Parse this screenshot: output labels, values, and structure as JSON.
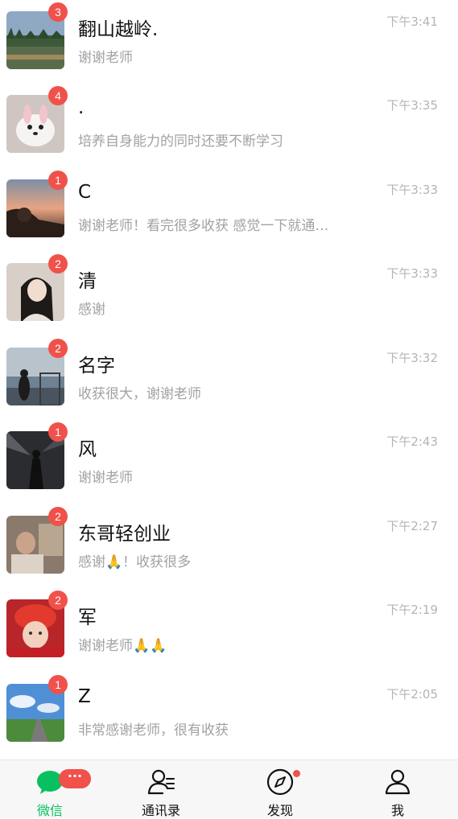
{
  "chats": [
    {
      "name": "翻山越岭.",
      "preview": "谢谢老师",
      "time": "下午3:41",
      "unread": "3",
      "avatar": "landscape-avatar"
    },
    {
      "name": ".",
      "preview": "培养自身能力的同时还要不断学习",
      "time": "下午3:35",
      "unread": "4",
      "avatar": "white-dog-avatar"
    },
    {
      "name": "C",
      "preview": "谢谢老师！看完很多收获 感觉一下就通…",
      "time": "下午3:33",
      "unread": "1",
      "avatar": "sunset-person-avatar"
    },
    {
      "name": "清",
      "preview": "感谢",
      "time": "下午3:33",
      "unread": "2",
      "avatar": "woman-portrait-avatar"
    },
    {
      "name": "名字",
      "preview": "收获很大，谢谢老师",
      "time": "下午3:32",
      "unread": "2",
      "avatar": "person-by-sea-avatar"
    },
    {
      "name": "风",
      "preview": "谢谢老师",
      "time": "下午2:43",
      "unread": "1",
      "avatar": "dark-figure-avatar"
    },
    {
      "name": "东哥轻创业",
      "preview": "感谢🙏！收获很多",
      "time": "下午2:27",
      "unread": "2",
      "avatar": "room-person-avatar"
    },
    {
      "name": "军",
      "preview": "谢谢老师🙏🙏",
      "time": "下午2:19",
      "unread": "2",
      "avatar": "child-red-hat-avatar"
    },
    {
      "name": "Z",
      "preview": "非常感谢老师，很有收获",
      "time": "下午2:05",
      "unread": "1",
      "avatar": "sky-road-avatar"
    }
  ],
  "tabs": [
    {
      "label": "微信",
      "icon": "chat-bubble-icon",
      "active": true
    },
    {
      "label": "通讯录",
      "icon": "contacts-icon",
      "active": false
    },
    {
      "label": "发现",
      "icon": "compass-icon",
      "active": false
    },
    {
      "label": "我",
      "icon": "person-icon",
      "active": false
    }
  ],
  "tab_badge": "···",
  "colors": {
    "accent": "#07c160",
    "badge": "#f0514a"
  }
}
